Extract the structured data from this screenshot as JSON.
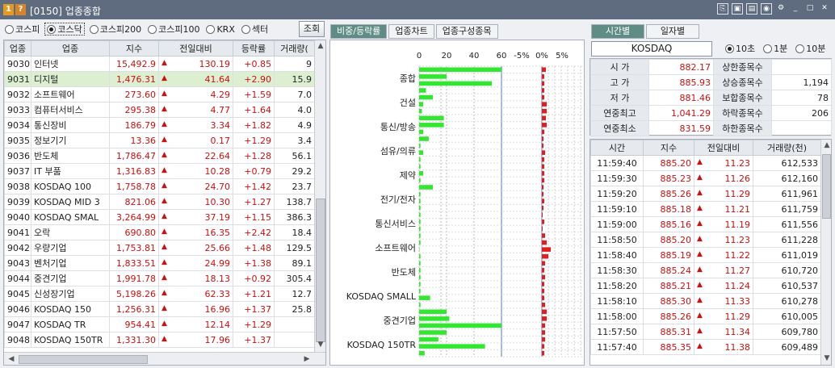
{
  "titlebar": {
    "title": "[0150] 업종종합",
    "badge1": "1",
    "badge2": "?"
  },
  "left": {
    "radios": [
      {
        "label": "코스피",
        "on": false
      },
      {
        "label": "코스닥",
        "on": true
      },
      {
        "label": "코스피200",
        "on": false
      },
      {
        "label": "코스피100",
        "on": false
      },
      {
        "label": "KRX",
        "on": false
      },
      {
        "label": "섹터",
        "on": false
      }
    ],
    "search_button": "조회",
    "headers": [
      "업종",
      "업종",
      "지수",
      "전일대비",
      "등락률",
      "거래량("
    ],
    "rows": [
      {
        "code": "9030",
        "name": "인터넷",
        "index": "15,492.9",
        "chg": "130.19",
        "rate": "+0.85",
        "vol": "9"
      },
      {
        "code": "9031",
        "name": "디지털",
        "index": "1,476.31",
        "chg": "41.64",
        "rate": "+2.90",
        "vol": "15.9"
      },
      {
        "code": "9032",
        "name": "소프트웨어",
        "index": "273.60",
        "chg": "4.29",
        "rate": "+1.59",
        "vol": "7.0"
      },
      {
        "code": "9033",
        "name": "컴퓨터서비스",
        "index": "295.38",
        "chg": "4.77",
        "rate": "+1.64",
        "vol": "4.0"
      },
      {
        "code": "9034",
        "name": "통신장비",
        "index": "186.79",
        "chg": "3.34",
        "rate": "+1.82",
        "vol": "4.9"
      },
      {
        "code": "9035",
        "name": "정보기기",
        "index": "13.36",
        "chg": "0.17",
        "rate": "+1.29",
        "vol": "3.4"
      },
      {
        "code": "9036",
        "name": "반도체",
        "index": "1,786.47",
        "chg": "22.64",
        "rate": "+1.28",
        "vol": "56.1"
      },
      {
        "code": "9037",
        "name": "IT 부품",
        "index": "1,316.83",
        "chg": "10.28",
        "rate": "+0.79",
        "vol": "29.2"
      },
      {
        "code": "9038",
        "name": "KOSDAQ 100",
        "index": "1,758.78",
        "chg": "24.70",
        "rate": "+1.42",
        "vol": "23.7"
      },
      {
        "code": "9039",
        "name": "KOSDAQ MID 3",
        "index": "821.06",
        "chg": "10.30",
        "rate": "+1.27",
        "vol": "138.7"
      },
      {
        "code": "9040",
        "name": "KOSDAQ SMAL",
        "index": "3,264.99",
        "chg": "37.19",
        "rate": "+1.15",
        "vol": "386.3"
      },
      {
        "code": "9041",
        "name": "오락",
        "index": "690.80",
        "chg": "16.35",
        "rate": "+2.42",
        "vol": "18.4"
      },
      {
        "code": "9042",
        "name": "우량기업",
        "index": "1,753.81",
        "chg": "25.66",
        "rate": "+1.48",
        "vol": "129.5"
      },
      {
        "code": "9043",
        "name": "벤처기업",
        "index": "1,833.51",
        "chg": "24.99",
        "rate": "+1.38",
        "vol": "89.1"
      },
      {
        "code": "9044",
        "name": "중견기업",
        "index": "1,991.78",
        "chg": "18.13",
        "rate": "+0.92",
        "vol": "305.4"
      },
      {
        "code": "9045",
        "name": "신성장기업",
        "index": "5,198.26",
        "chg": "62.33",
        "rate": "+1.21",
        "vol": "12.7"
      },
      {
        "code": "9046",
        "name": "KOSDAQ 150",
        "index": "1,256.31",
        "chg": "16.96",
        "rate": "+1.37",
        "vol": "25.8"
      },
      {
        "code": "9047",
        "name": "KOSDAQ TR",
        "index": "954.41",
        "chg": "12.14",
        "rate": "+1.29",
        "vol": ""
      },
      {
        "code": "9048",
        "name": "KOSDAQ 150TR",
        "index": "1,331.30",
        "chg": "17.96",
        "rate": "+1.37",
        "vol": ""
      }
    ]
  },
  "middle": {
    "tabs": [
      "비중/등락률",
      "업종차트",
      "업종구성종목"
    ],
    "top_ticks": [
      "0",
      "20",
      "40",
      "60",
      "-5%",
      "0%",
      "5%"
    ],
    "category_labels": [
      "종합",
      "건설",
      "통신/방송",
      "섬유/의류",
      "제약",
      "전기/전자",
      "통신서비스",
      "소프트웨어",
      "반도체",
      "KOSDAQ SMALL",
      "중견기업",
      "KOSDAQ 150TR"
    ],
    "green_bars": [
      60,
      20,
      53,
      5,
      10,
      3,
      2,
      18,
      18,
      3,
      7,
      1,
      3,
      1,
      1,
      3,
      1,
      10,
      1,
      1,
      1,
      1,
      1,
      1,
      1,
      1,
      0,
      1,
      1,
      1,
      1,
      1,
      1,
      8,
      1,
      20,
      22,
      60,
      20,
      14,
      48,
      4
    ],
    "red_bars": [
      1,
      0.6,
      0.6,
      0.6,
      0.6,
      1.2,
      1.2,
      1.0,
      1.2,
      0.6,
      0.4,
      0.4,
      0.8,
      0.6,
      0.6,
      0.6,
      0.6,
      0.4,
      0.4,
      0.6,
      0.4,
      0.2,
      0.6,
      0.2,
      0.8,
      1.2,
      2.2,
      1.6,
      0.8,
      0.6,
      0.8,
      0.6,
      0.6,
      0.6,
      0.8,
      1.2,
      1.2,
      0.8,
      0.8,
      0.8,
      0.6,
      0.6
    ]
  },
  "right": {
    "tabs": [
      "시간별",
      "일자별"
    ],
    "market": "KOSDAQ",
    "interval_radios": [
      {
        "label": "10초",
        "on": true
      },
      {
        "label": "1분",
        "on": false
      },
      {
        "label": "10분",
        "on": false
      }
    ],
    "summary": [
      {
        "l1": "시 가",
        "v1": "882.17",
        "l2": "상한종목수",
        "v2": ""
      },
      {
        "l1": "고 가",
        "v1": "885.93",
        "l2": "상승종목수",
        "v2": "1,194"
      },
      {
        "l1": "저 가",
        "v1": "881.46",
        "l2": "보합종목수",
        "v2": "78"
      },
      {
        "l1": "연중최고",
        "v1": "1,041.29",
        "l2": "하락종목수",
        "v2": "206"
      },
      {
        "l1": "연중최소",
        "v1": "831.59",
        "l2": "하한종목수",
        "v2": ""
      }
    ],
    "headers": [
      "시간",
      "지수",
      "전일대비",
      "거래량(천)"
    ],
    "rows": [
      {
        "t": "11:59:40",
        "idx": "885.20",
        "chg": "11.23",
        "vol": "612,533"
      },
      {
        "t": "11:59:30",
        "idx": "885.23",
        "chg": "11.26",
        "vol": "612,160"
      },
      {
        "t": "11:59:20",
        "idx": "885.26",
        "chg": "11.29",
        "vol": "611,961"
      },
      {
        "t": "11:59:10",
        "idx": "885.18",
        "chg": "11.21",
        "vol": "611,759"
      },
      {
        "t": "11:59:00",
        "idx": "885.16",
        "chg": "11.19",
        "vol": "611,556"
      },
      {
        "t": "11:58:50",
        "idx": "885.20",
        "chg": "11.23",
        "vol": "611,228"
      },
      {
        "t": "11:58:40",
        "idx": "885.19",
        "chg": "11.22",
        "vol": "611,019"
      },
      {
        "t": "11:58:30",
        "idx": "885.24",
        "chg": "11.27",
        "vol": "610,720"
      },
      {
        "t": "11:58:20",
        "idx": "885.21",
        "chg": "11.24",
        "vol": "610,537"
      },
      {
        "t": "11:58:10",
        "idx": "885.30",
        "chg": "11.33",
        "vol": "610,278"
      },
      {
        "t": "11:58:00",
        "idx": "885.26",
        "chg": "11.29",
        "vol": "610,005"
      },
      {
        "t": "11:57:50",
        "idx": "885.31",
        "chg": "11.34",
        "vol": "609,780"
      },
      {
        "t": "11:57:40",
        "idx": "885.35",
        "chg": "11.38",
        "vol": "609,489"
      }
    ]
  }
}
